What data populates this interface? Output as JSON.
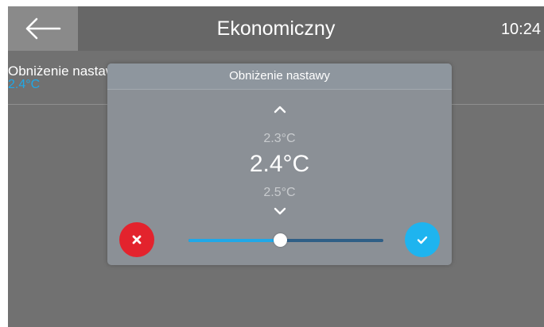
{
  "header": {
    "title": "Ekonomiczny",
    "time": "10:24",
    "back_icon": "arrow-left-icon"
  },
  "setting": {
    "label": "Obniżenie nastawy",
    "value": "2.4°C"
  },
  "dialog": {
    "title": "Obniżenie nastawy",
    "previous_option": "2.3°C",
    "current_value": "2.4°C",
    "next_option": "2.5°C",
    "up_icon": "chevron-up-icon",
    "down_icon": "chevron-down-icon",
    "cancel_icon": "close-icon",
    "confirm_icon": "check-icon",
    "slider_fraction": 0.47
  },
  "colors": {
    "accent": "#1fa8e8",
    "cancel": "#e3232d",
    "confirm": "#1eb4ef"
  }
}
